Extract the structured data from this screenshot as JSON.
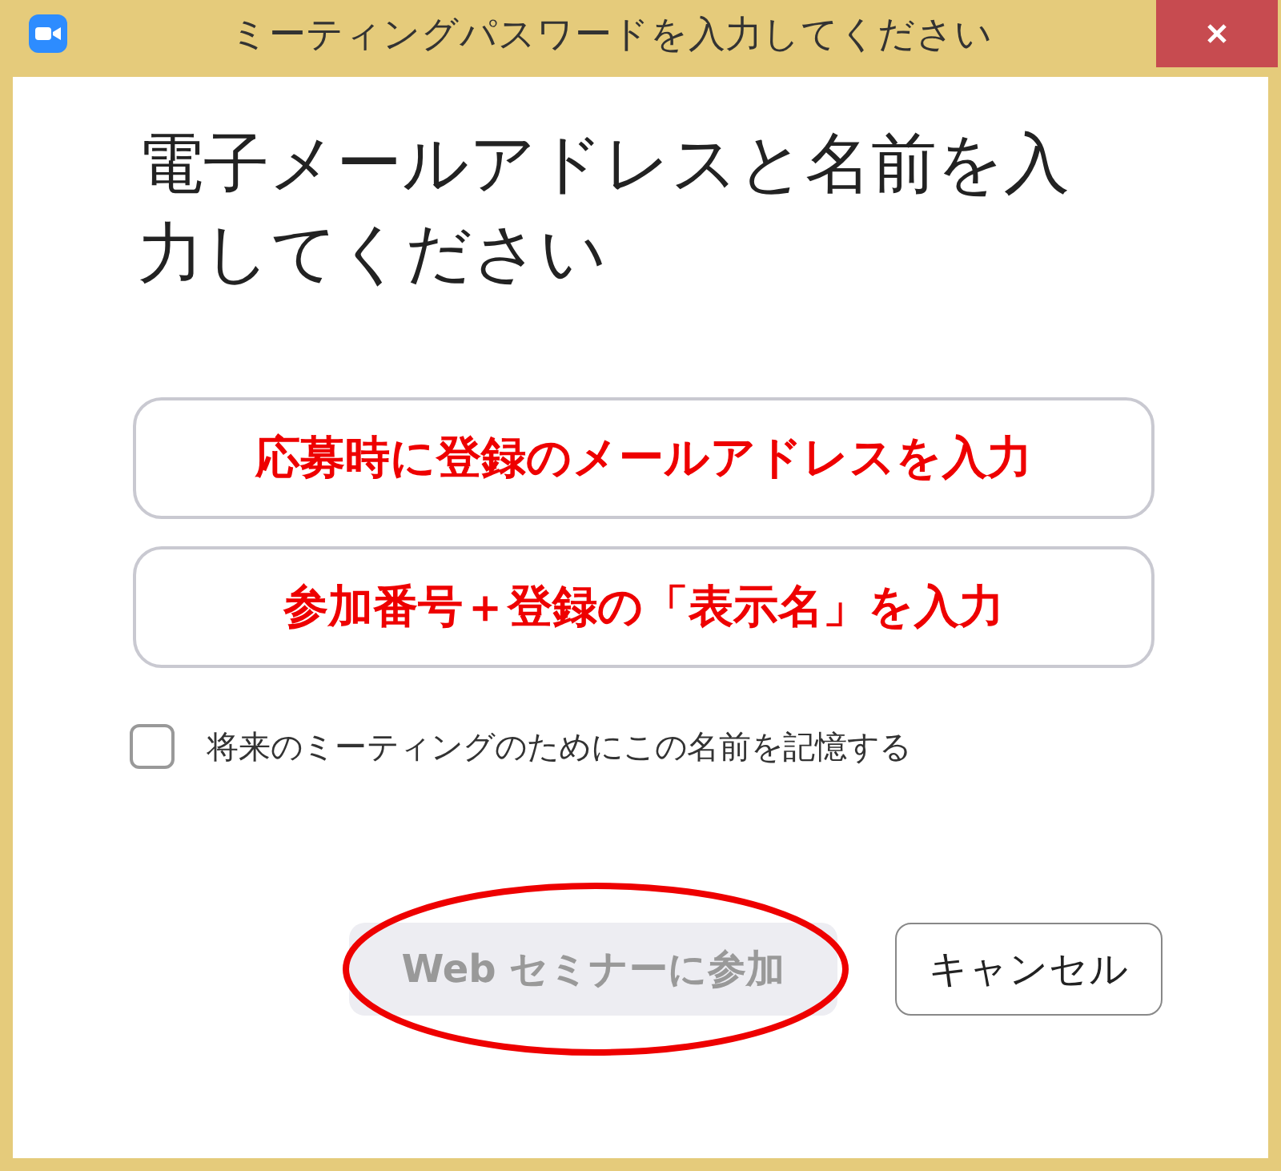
{
  "window": {
    "title": "ミーティングパスワードを入力してください"
  },
  "heading": "電子メールアドレスと名前を入力してください",
  "fields": [
    {
      "value": "応募時に登録のメールアドレスを入力"
    },
    {
      "value": "参加番号＋登録の「表示名」を入力"
    }
  ],
  "remember": {
    "label": "将来のミーティングのためにこの名前を記憶する",
    "checked": false
  },
  "buttons": [
    {
      "label": "Web セミナーに参加",
      "disabled": true,
      "highlighted": true
    },
    {
      "label": "キャンセル",
      "disabled": false,
      "highlighted": false
    }
  ]
}
